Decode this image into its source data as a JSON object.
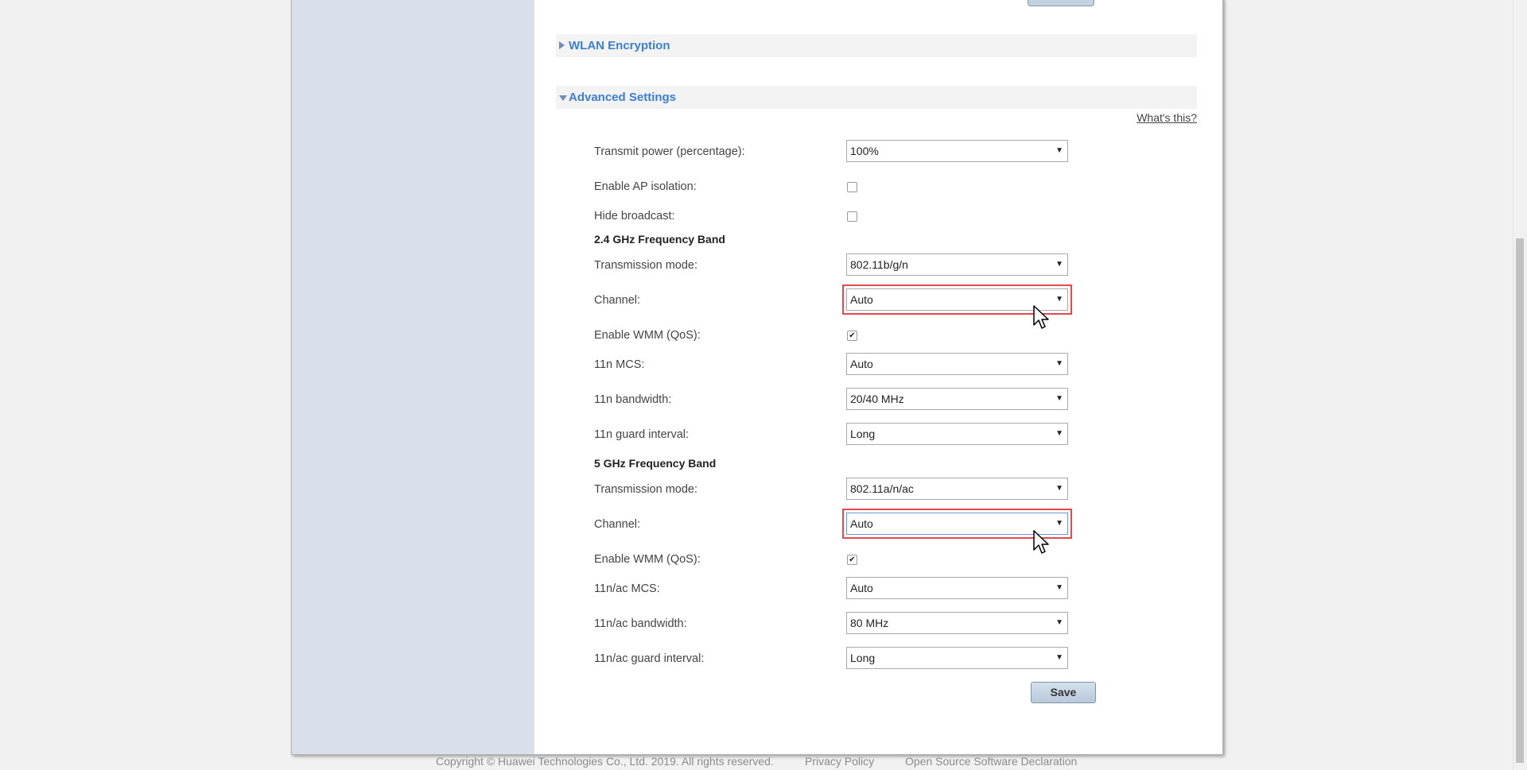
{
  "sections": {
    "wlan_encryption": "WLAN Encryption",
    "advanced_settings": "Advanced Settings"
  },
  "whats_this": "What's this?",
  "general": {
    "transmit_power": {
      "label": "Transmit power (percentage):",
      "value": "100%"
    },
    "ap_isolation": {
      "label": "Enable AP isolation:",
      "checked": false
    },
    "hide_broadcast": {
      "label": "Hide broadcast:",
      "checked": false
    }
  },
  "band_24": {
    "title": "2.4 GHz Frequency Band",
    "transmission_mode": {
      "label": "Transmission mode:",
      "value": "802.11b/g/n"
    },
    "channel": {
      "label": "Channel:",
      "value": "Auto"
    },
    "wmm": {
      "label": "Enable WMM (QoS):",
      "checked": true
    },
    "mcs": {
      "label": "11n MCS:",
      "value": "Auto"
    },
    "bandwidth": {
      "label": "11n bandwidth:",
      "value": "20/40 MHz"
    },
    "guard_interval": {
      "label": "11n guard interval:",
      "value": "Long"
    }
  },
  "band_5": {
    "title": "5 GHz Frequency Band",
    "transmission_mode": {
      "label": "Transmission mode:",
      "value": "802.11a/n/ac"
    },
    "channel": {
      "label": "Channel:",
      "value": "Auto"
    },
    "wmm": {
      "label": "Enable WMM (QoS):",
      "checked": true
    },
    "mcs": {
      "label": "11n/ac MCS:",
      "value": "Auto"
    },
    "bandwidth": {
      "label": "11n/ac bandwidth:",
      "value": "80 MHz"
    },
    "guard_interval": {
      "label": "11n/ac guard interval:",
      "value": "Long"
    }
  },
  "save_label": "Save",
  "footer": {
    "copyright": "Copyright © Huawei Technologies Co., Ltd. 2019. All rights reserved.",
    "privacy": "Privacy Policy",
    "open_source": "Open Source Software Declaration"
  },
  "checkmark_glyph": "✔",
  "dropdown_glyph": "▼",
  "colors": {
    "accent": "#3b7ed6",
    "highlight": "#e5484d",
    "sidebar": "#d9e0eb"
  }
}
